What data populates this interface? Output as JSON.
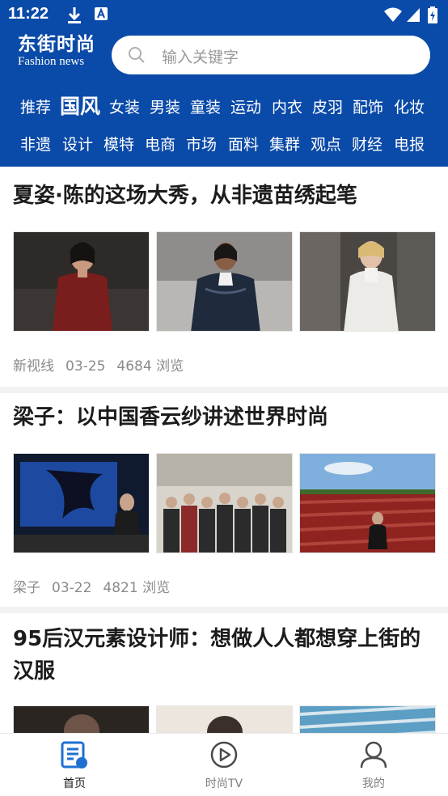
{
  "status": {
    "time": "11:22"
  },
  "brand": {
    "name_cn": "东街时尚",
    "name_en": "Fashion news"
  },
  "search": {
    "placeholder": "输入关键字"
  },
  "categories_row1": [
    "推荐",
    "国风",
    "女装",
    "男装",
    "童装",
    "运动",
    "内衣",
    "皮羽",
    "配饰",
    "化妆"
  ],
  "categories_row2": [
    "非遗",
    "设计",
    "模特",
    "电商",
    "市场",
    "面料",
    "集群",
    "观点",
    "财经",
    "电报"
  ],
  "active_category": "国风",
  "articles": [
    {
      "title": "夏姿·陈的这场大秀，从非遗苗绣起笔",
      "source": "新视线",
      "date": "03-25",
      "views": "4684 浏览",
      "images": [
        "runway-red-leather-dress",
        "runway-black-satin-jacket",
        "runway-white-coat"
      ]
    },
    {
      "title": "梁子：以中国香云纱讲述世界时尚",
      "source": "梁子",
      "date": "03-22",
      "views": "4821 浏览",
      "images": [
        "presentation-stage-screen",
        "group-photo-exhibition",
        "woman-on-red-field"
      ]
    },
    {
      "title": "95后汉元素设计师：想做人人都想穿上街的汉服",
      "images": [
        "designer-portrait-dark",
        "designer-portrait-light",
        "fabric-blue-pattern"
      ]
    }
  ],
  "bottom_nav": [
    {
      "label": "首页",
      "icon": "news-doc-icon",
      "active": true
    },
    {
      "label": "时尚TV",
      "icon": "play-circle-icon",
      "active": false
    },
    {
      "label": "我的",
      "icon": "user-icon",
      "active": false
    }
  ],
  "colors": {
    "primary": "#0a4aa8",
    "accent": "#1f6fd1",
    "meta": "#8a8a8a"
  }
}
